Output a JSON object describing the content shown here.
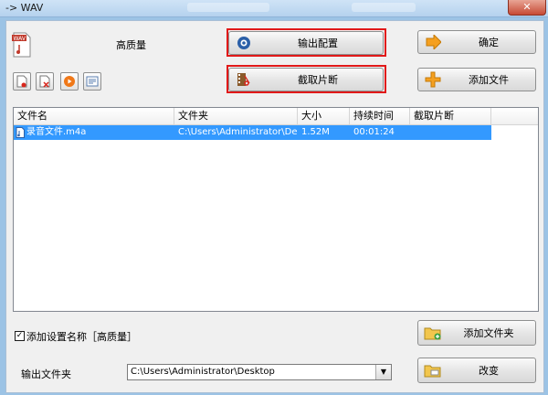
{
  "window": {
    "title": "-> WAV",
    "close_glyph": "✕"
  },
  "preset": {
    "label": "高质量"
  },
  "buttons": {
    "output_config": "输出配置",
    "ok": "确定",
    "clip": "截取片断",
    "add_file": "添加文件",
    "add_folder": "添加文件夹",
    "change": "改变"
  },
  "toolbar_icons": [
    "remove-file-icon",
    "clear-list-icon",
    "play-icon",
    "media-info-icon"
  ],
  "table": {
    "columns": [
      "文件名",
      "文件夹",
      "大小",
      "持续时间",
      "截取片断"
    ],
    "rows": [
      {
        "name": "录音文件.m4a",
        "folder": "C:\\Users\\Administrator\\Des...",
        "size": "1.52M",
        "duration": "00:01:24",
        "clip": ""
      }
    ]
  },
  "bottom": {
    "checkbox_label": "添加设置名称［高质量］",
    "checked": true,
    "output_folder_label": "输出文件夹",
    "output_folder_value": "C:\\Users\\Administrator\\Desktop"
  },
  "colors": {
    "highlight": "#e11919",
    "selection": "#3399ff",
    "accent": "#f5a020"
  }
}
